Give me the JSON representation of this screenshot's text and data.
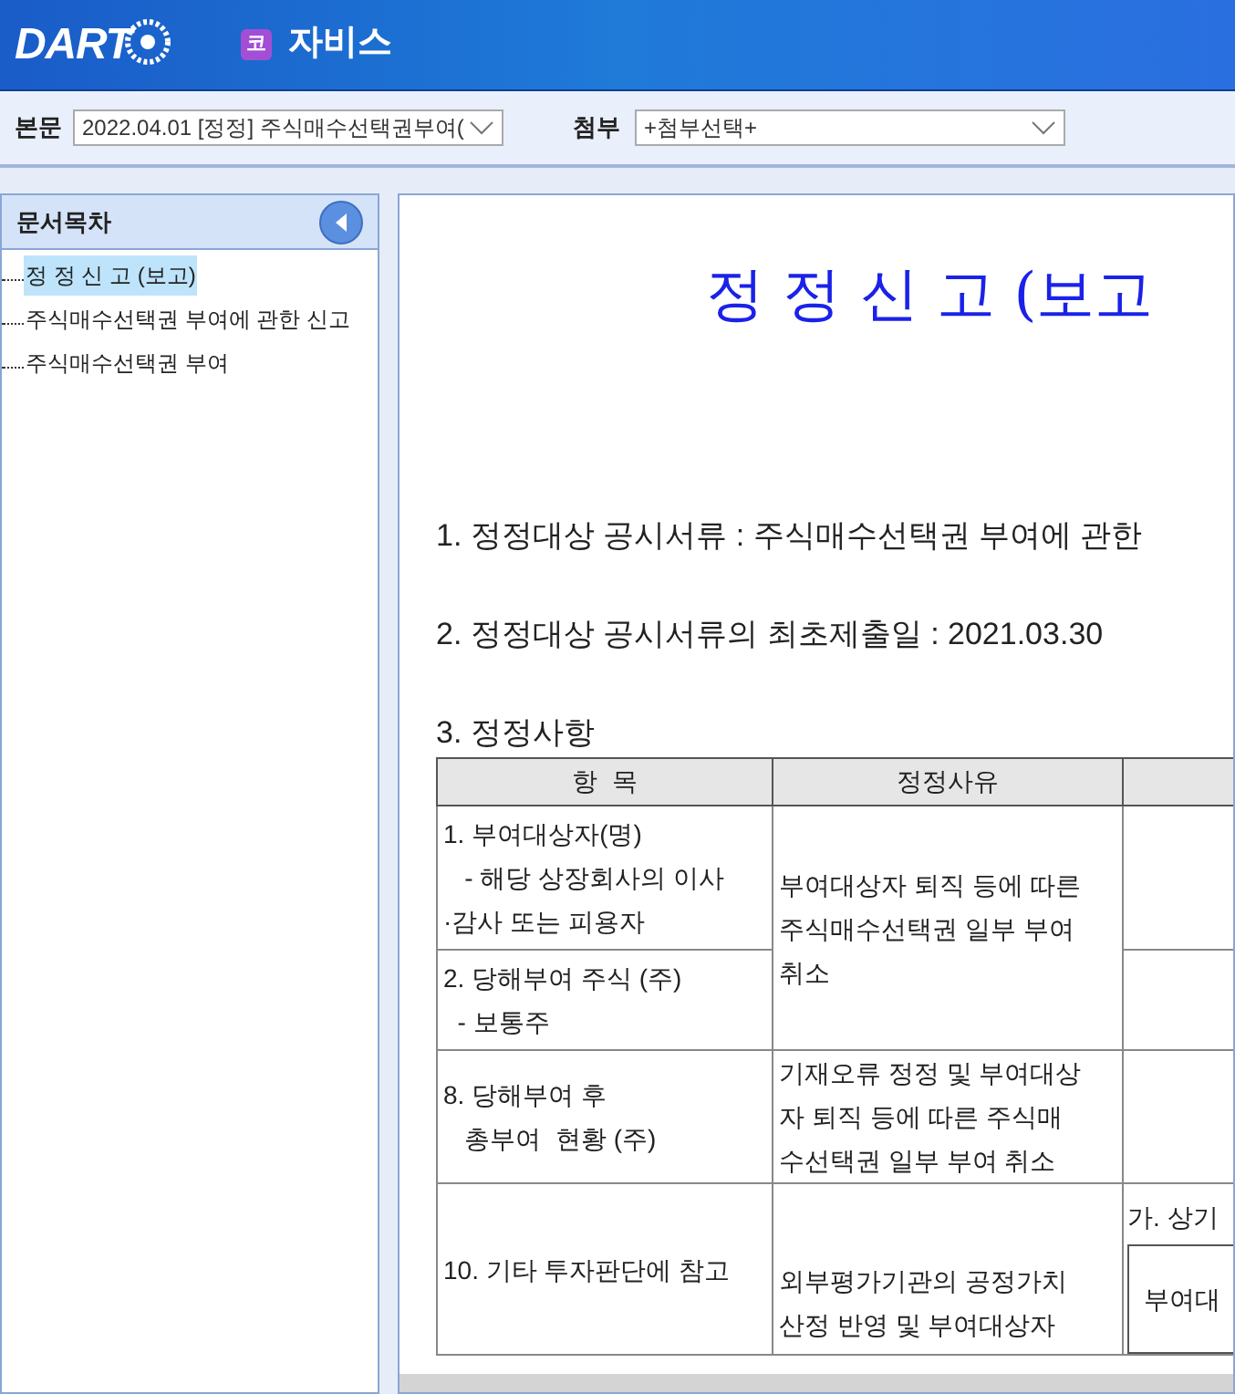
{
  "header": {
    "logo": "DART",
    "app_badge": "코",
    "app_name": "자비스"
  },
  "toolbar": {
    "main_label": "본문",
    "main_select": "2022.04.01  [정정] 주식매수선택권부여(",
    "attach_label": "첨부",
    "attach_select": "+첨부선택+"
  },
  "sidebar": {
    "title": "문서목차",
    "items": [
      {
        "label": "정 정 신 고 (보고)",
        "selected": true
      },
      {
        "label": "주식매수선택권 부여에 관한 신고",
        "selected": false
      },
      {
        "label": "주식매수선택권 부여",
        "selected": false
      }
    ]
  },
  "document": {
    "title": "정 정 신 고 (보고",
    "lines": [
      "1. 정정대상 공시서류 : 주식매수선택권 부여에 관한",
      "2. 정정대상 공시서류의 최초제출일 : 2021.03.30",
      "3. 정정사항"
    ],
    "table": {
      "columns": [
        "항  목",
        "정정사유"
      ],
      "rows": [
        {
          "item": [
            "1. 부여대상자(명)",
            "   - 해당 상장회사의 이사",
            "·감사 또는 피용자"
          ],
          "reason": [
            "부여대상자 퇴직 등에 따른",
            "주식매수선택권 일부 부여",
            "취소"
          ]
        },
        {
          "item": [
            "2. 당해부여 주식 (주)",
            "  - 보통주"
          ]
        },
        {
          "item": [
            "8. 당해부여 후",
            "   총부여  현황 (주)"
          ],
          "reason": [
            "기재오류 정정 및 부여대상",
            "자 퇴직 등에 따른 주식매",
            "수선택권 일부 부여 취소"
          ]
        },
        {
          "item": [
            "10. 기타 투자판단에 참고"
          ],
          "reason": [
            "외부평가기관의 공정가치",
            "산정 반영 및 부여대상자"
          ],
          "column_3": {
            "text": "가. 상기",
            "box_text": "부여대"
          }
        }
      ]
    }
  }
}
